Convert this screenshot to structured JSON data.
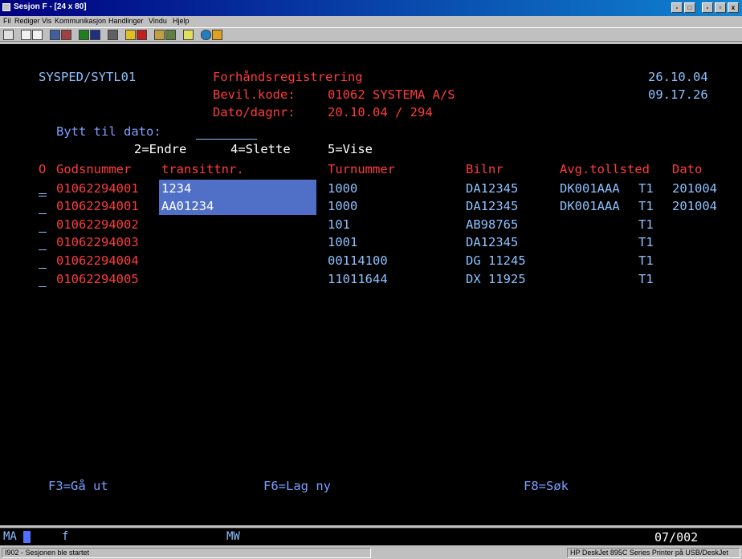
{
  "window": {
    "title": "Sesjon F - [24 x 80]",
    "buttons": [
      "-",
      "□",
      "-",
      "▫",
      "x"
    ]
  },
  "menu": [
    "Fil",
    "Rediger",
    "Vis",
    "Kommunikasjon",
    "Handlinger",
    "Vindu",
    "Hjelp"
  ],
  "header": {
    "program": "SYSPED/SYTL01",
    "title": "Forhåndsregistrering",
    "date": "26.10.04",
    "bevil_label": "Bevil.kode:",
    "bevil_value": "01062 SYSTEMA A/S",
    "time": "09.17.26",
    "dato_label": "Dato/dagnr:",
    "dato_value": "20.10.04 / 294"
  },
  "change_date": {
    "label": "Bytt til dato:",
    "value": ""
  },
  "options": {
    "edit": "2=Endre",
    "delete": "4=Slette",
    "view": "5=Vise"
  },
  "columns": {
    "opt": "O",
    "godsnr": "Godsnummer",
    "transitt": "transittnr.",
    "tur": "Turnummer",
    "bil": "Bilnr",
    "avg": "Avg.tollsted",
    "dato": "Dato"
  },
  "rows": [
    {
      "opt": "",
      "godsnr": "01062294001",
      "transitt": "1234",
      "tur": "1000",
      "bil": "DA12345",
      "avg": "DK001AAA",
      "t": "T1",
      "dato": "201004"
    },
    {
      "opt": "",
      "godsnr": "01062294001",
      "transitt": "AA01234",
      "tur": "1000",
      "bil": "DA12345",
      "avg": "DK001AAA",
      "t": "T1",
      "dato": "201004"
    },
    {
      "opt": "",
      "godsnr": "01062294002",
      "transitt": "",
      "tur": "101",
      "bil": "AB98765",
      "avg": "",
      "t": "T1",
      "dato": ""
    },
    {
      "opt": "",
      "godsnr": "01062294003",
      "transitt": "",
      "tur": "1001",
      "bil": "DA12345",
      "avg": "",
      "t": "T1",
      "dato": ""
    },
    {
      "opt": "",
      "godsnr": "01062294004",
      "transitt": "",
      "tur": "00114100",
      "bil": "DG 11245",
      "avg": "",
      "t": "T1",
      "dato": ""
    },
    {
      "opt": "",
      "godsnr": "01062294005",
      "transitt": "",
      "tur": "11011644",
      "bil": "DX 11925",
      "avg": "",
      "t": "T1",
      "dato": ""
    }
  ],
  "fkeys": {
    "f3": "F3=Gå ut",
    "f6": "F6=Lag ny",
    "f8": "F8=Søk"
  },
  "oia": {
    "ma": "MA",
    "f": "f",
    "mw": "MW",
    "pos": "07/002"
  },
  "status": {
    "left": "I902 - Sesjonen ble startet",
    "right": "HP DeskJet 895C Series Printer på USB/DeskJet"
  }
}
